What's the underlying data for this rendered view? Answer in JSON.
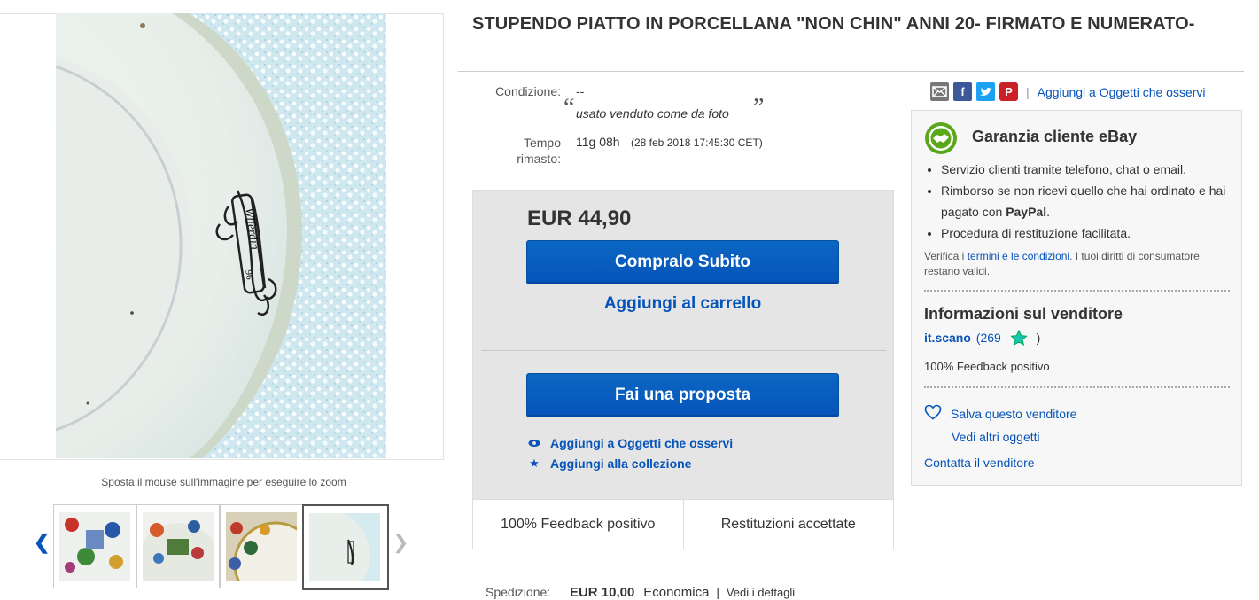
{
  "item": {
    "title": "STUPENDO PIATTO IN PORCELLANA \"NON CHIN\" ANNI 20- FIRMATO E NUMERATO-"
  },
  "gallery": {
    "zoom_hint": "Sposta il mouse sull'immagine per eseguire lo zoom",
    "prev_icon": "chevron-left-icon",
    "next_icon": "chevron-right-icon",
    "thumbnail_count": 4,
    "selected_thumbnail": 4
  },
  "details": {
    "condition_label": "Condizione:",
    "condition_value": "--",
    "condition_note": "usato venduto come da foto",
    "time_label": "Tempo rimasto:",
    "time_value": "11g 08h",
    "time_detail": "(28 feb 2018  17:45:30 CET)"
  },
  "buy_box": {
    "price": "EUR 44,90",
    "buy_now": "Compralo Subito",
    "add_to_cart": "Aggiungi al carrello",
    "make_offer": "Fai una proposta",
    "watch": "Aggiungi a Oggetti che osservi",
    "collection": "Aggiungi alla collezione",
    "feedback": "100% Feedback positivo",
    "returns": "Restituzioni accettate"
  },
  "shipping": {
    "label": "Spedizione:",
    "price": "EUR 10,00",
    "method": "Economica",
    "separator": "|",
    "details_link": "Vedi i dettagli"
  },
  "share": {
    "icons": [
      "email-icon",
      "facebook-icon",
      "twitter-icon",
      "pinterest-icon"
    ],
    "separator": "|",
    "watch_link": "Aggiungi a Oggetti che osservi"
  },
  "guarantee": {
    "title": "Garanzia cliente eBay",
    "items": [
      "Servizio clienti tramite telefono, chat o email.",
      "Rimborso se non ricevi quello che hai ordinato e hai pagato con",
      "Procedura di restituzione facilitata."
    ],
    "paypal": "PayPal",
    "terms_prefix": "Verifica i",
    "terms_link": "termini e le condizioni",
    "terms_suffix": ". I tuoi diritti di consumatore restano validi."
  },
  "seller": {
    "title": "Informazioni sul venditore",
    "name": "it.scano",
    "score_open": "(",
    "score": "269",
    "score_close": ")",
    "feedback": "100% Feedback positivo",
    "save": "Salva questo venditore",
    "more_items": "Vedi altri oggetti",
    "contact": "Contatta il venditore"
  },
  "colors": {
    "link": "#0654ba",
    "button": "#0654ba",
    "buy_box_bg": "#e5e5e5",
    "guarantee_green": "#5ba71b",
    "star": "#19c4b1"
  }
}
